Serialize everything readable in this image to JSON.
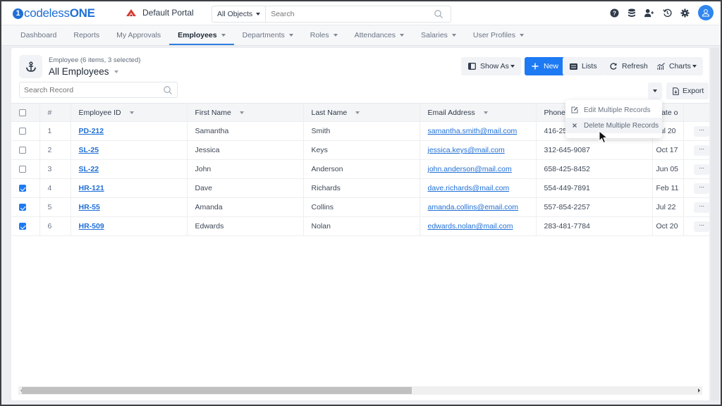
{
  "app": {
    "logo_prefix": "codeless",
    "logo_suffix": "ONE",
    "logo_mark": "1",
    "portal_name": "Default Portal"
  },
  "global_search": {
    "scope": "All Objects",
    "placeholder": "Search"
  },
  "top_icons": [
    "help-icon",
    "database-icon",
    "add-user-icon",
    "history-icon",
    "settings-icon",
    "user-avatar"
  ],
  "nav": {
    "tabs": [
      {
        "label": "Dashboard",
        "dropdown": false,
        "active": false
      },
      {
        "label": "Reports",
        "dropdown": false,
        "active": false
      },
      {
        "label": "My Approvals",
        "dropdown": false,
        "active": false
      },
      {
        "label": "Employees",
        "dropdown": true,
        "active": true
      },
      {
        "label": "Departments",
        "dropdown": true,
        "active": false
      },
      {
        "label": "Roles",
        "dropdown": true,
        "active": false
      },
      {
        "label": "Attendances",
        "dropdown": true,
        "active": false
      },
      {
        "label": "Salaries",
        "dropdown": true,
        "active": false
      },
      {
        "label": "User Profiles",
        "dropdown": true,
        "active": false
      }
    ]
  },
  "view": {
    "object_summary": "Employee (6 items, 3 selected)",
    "title": "All Employees",
    "search_placeholder": "Search Record"
  },
  "toolbar": {
    "show_as": "Show As",
    "new": "New",
    "lists": "Lists",
    "refresh": "Refresh",
    "charts": "Charts",
    "export": "Export"
  },
  "bulk_menu": {
    "items": [
      {
        "label": "Edit Multiple Records",
        "icon": "edit-icon"
      },
      {
        "label": "Delete Multiple Records",
        "icon": "close-icon"
      }
    ]
  },
  "table": {
    "columns": [
      "#",
      "Employee ID",
      "First Name",
      "Last Name",
      "Email Address",
      "Phone",
      "Date o"
    ],
    "rows": [
      {
        "checked": false,
        "num": "1",
        "id": "PD-212",
        "first": "Samantha",
        "last": "Smith",
        "email": "samantha.smith@mail.com",
        "phone": "416-25",
        "date": "Jul 20"
      },
      {
        "checked": false,
        "num": "2",
        "id": "SL-25",
        "first": "Jessica",
        "last": "Keys",
        "email": "jessica.keys@mail.com",
        "phone": "312-645-9087",
        "date": "Oct 17"
      },
      {
        "checked": false,
        "num": "3",
        "id": "SL-22",
        "first": "John",
        "last": "Anderson",
        "email": "john.anderson@mail.com",
        "phone": "658-425-8452",
        "date": "Jun 05"
      },
      {
        "checked": true,
        "num": "4",
        "id": "HR-121",
        "first": "Dave",
        "last": "Richards",
        "email": "dave.richards@mail.com",
        "phone": "554-449-7891",
        "date": "Feb 11"
      },
      {
        "checked": true,
        "num": "5",
        "id": "HR-55",
        "first": "Amanda",
        "last": "Collins",
        "email": "amanda.collins@email.com",
        "phone": "557-854-2257",
        "date": "Jul 22"
      },
      {
        "checked": true,
        "num": "6",
        "id": "HR-509",
        "first": "Edwards",
        "last": "Nolan",
        "email": "edwards.nolan@mail.com",
        "phone": "283-481-7784",
        "date": "Oct 20"
      }
    ],
    "row_action_label": "···"
  },
  "scroll": {
    "horizontal_position_fraction": 0.57
  },
  "colors": {
    "brand": "#1f6fd6",
    "primary_button": "#1d7af3",
    "portal_icon": "#d63b2f"
  }
}
